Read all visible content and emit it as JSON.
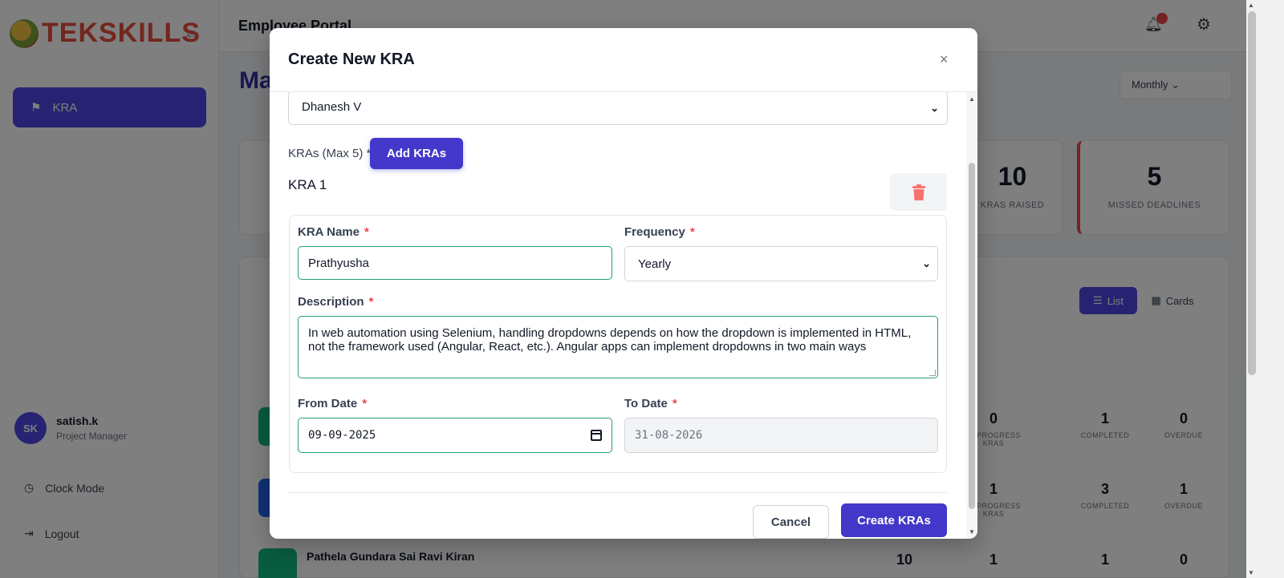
{
  "app": {
    "logo_text": "TEKSKILLS",
    "portal_title": "Employee Portal",
    "page_heading": "Ma",
    "month_filter": "Monthly"
  },
  "sidebar": {
    "active_item": "KRA",
    "user": {
      "initials": "SK",
      "name": "satish.k",
      "role": "Project Manager"
    },
    "links": [
      {
        "label": "Clock Mode"
      },
      {
        "label": "Logout"
      }
    ]
  },
  "stats": [
    {
      "value": "10",
      "label": "KRAS RAISED"
    },
    {
      "value": "5",
      "label": "MISSED DEADLINES"
    }
  ],
  "list": {
    "view_buttons": [
      "List",
      "Cards"
    ],
    "rows": [
      {
        "cols": [
          {
            "value": "0",
            "label": "IN PROGRESS KRAS"
          },
          {
            "value": "1",
            "label": "COMPLETED"
          },
          {
            "value": "0",
            "label": "OVERDUE"
          }
        ]
      },
      {
        "cols": [
          {
            "value": "1",
            "label": "IN PROGRESS KRAS"
          },
          {
            "value": "3",
            "label": "COMPLETED"
          },
          {
            "value": "1",
            "label": "OVERDUE"
          }
        ]
      },
      {
        "name": "Pathela Gundara Sai Ravi Kiran",
        "cols": [
          {
            "value": "10"
          },
          {
            "value": "1"
          },
          {
            "value": "1"
          },
          {
            "value": "0"
          }
        ]
      }
    ]
  },
  "modal": {
    "title": "Create New KRA",
    "close_symbol": "×",
    "employee": "Dhanesh V",
    "kras_label": "KRAs (Max 5) *",
    "add_kras_label": "Add KRAs",
    "kra_heading": "KRA 1",
    "fields": {
      "kra_name_label": "KRA Name",
      "kra_name_value": "Prathyusha",
      "frequency_label": "Frequency",
      "frequency_value": "Yearly",
      "description_label": "Description",
      "description_value": "In web automation using Selenium, handling dropdowns depends on how the dropdown is implemented in HTML, not the framework used (Angular, React, etc.). Angular apps can implement dropdowns in two main ways",
      "from_date_label": "From Date",
      "from_date_value": "09-09-2025",
      "to_date_label": "To Date",
      "to_date_value": "31-08-2026",
      "required_mark": "*"
    },
    "cancel_label": "Cancel",
    "create_label": "Create KRAs"
  },
  "colors": {
    "primary": "#4338ca",
    "valid_border": "#22a06b",
    "required": "#ef4444",
    "delete_icon": "#f87171"
  }
}
